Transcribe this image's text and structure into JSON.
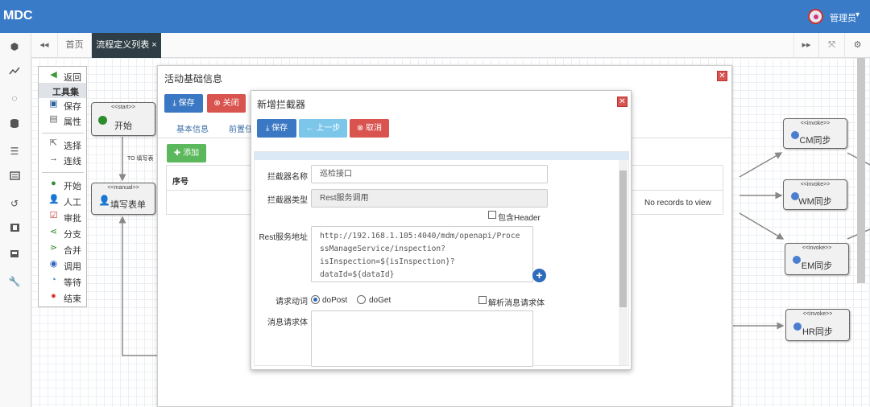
{
  "app": {
    "brand": "MDC",
    "user": "管理员"
  },
  "rail": {
    "icons": [
      "cube-icon",
      "chart-icon",
      "spinner-icon",
      "database-icon",
      "list-icon",
      "newspaper-icon",
      "history-icon",
      "film-icon",
      "inbox-icon",
      "wrench-icon"
    ]
  },
  "tabs": {
    "prev": "◂◂",
    "next": "▸▸",
    "items": [
      {
        "label": "首页"
      },
      {
        "label": "流程定义列表 ×"
      }
    ]
  },
  "toolbox": {
    "items": [
      {
        "label": "返回",
        "icon": "back-arrow-icon"
      },
      {
        "label": "工具集",
        "icon": ""
      },
      {
        "label": "保存",
        "icon": "save-icon"
      },
      {
        "label": "属性",
        "icon": "properties-icon"
      },
      {
        "label": "选择",
        "icon": "cursor-icon"
      },
      {
        "label": "连线",
        "icon": "connector-icon"
      },
      {
        "label": "开始",
        "icon": "start-icon"
      },
      {
        "label": "人工",
        "icon": "person-icon"
      },
      {
        "label": "审批",
        "icon": "approve-icon"
      },
      {
        "label": "分支",
        "icon": "fork-icon"
      },
      {
        "label": "合并",
        "icon": "join-icon"
      },
      {
        "label": "调用",
        "icon": "invoke-icon"
      },
      {
        "label": "等待",
        "icon": "wait-icon"
      },
      {
        "label": "结束",
        "icon": "end-icon"
      }
    ]
  },
  "diagram": {
    "nodes": [
      {
        "stereo": "<<start>>",
        "name": "开始"
      },
      {
        "stereo": "<<manual>>",
        "name": "填写表单"
      },
      {
        "stereo": "<<invoke>>",
        "name": "CM同步"
      },
      {
        "stereo": "<<invoke>>",
        "name": "WM同步"
      },
      {
        "stereo": "<<invoke>>",
        "name": "EM同步"
      },
      {
        "stereo": "<<invoke>>",
        "name": "HR同步"
      }
    ],
    "edge_label": "TO 填写表"
  },
  "activity_dialog": {
    "title": "活动基础信息",
    "save": "保存",
    "close": "关闭",
    "tabs": [
      "基本信息",
      "前置任"
    ],
    "add": "添加",
    "table_header": "序号",
    "empty": "No records to view"
  },
  "interceptor_dialog": {
    "title": "新增拦截器",
    "save": "保存",
    "prev": "上一步",
    "cancel": "取消",
    "name_label": "拦截器名称",
    "name_value": "巡检接口",
    "type_label": "拦截器类型",
    "type_value": "Rest服务调用",
    "header_label": "包含Header",
    "url_label": "Rest服务地址",
    "url_lines": [
      "http://192.168.1.105:4040/mdm/openapi/Proce",
      "ssManageService/inspection?",
      "isInspection=${isInspection}?dataId=${dataId}"
    ],
    "method_label": "请求动词",
    "method_post": "doPost",
    "method_get": "doGet",
    "parse_label": "解析消息请求体",
    "body_label": "消息请求体"
  },
  "colors": {
    "header": "#3a7bc8",
    "primary": "#3b78c3",
    "danger": "#d9534f",
    "success": "#5cb85c",
    "info": "#7cc6ea"
  }
}
